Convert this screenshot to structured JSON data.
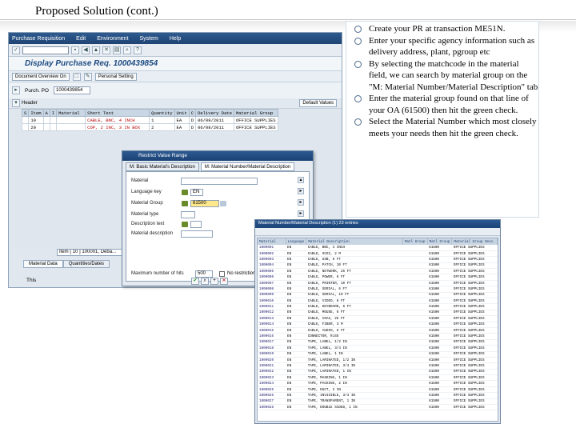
{
  "slide": {
    "title": "Proposed Solution (cont.)",
    "bullets": [
      "Create your PR at transaction ME51N.",
      "Enter your specific agency information such as delivery address, plant, pgroup etc",
      "By selecting the matchcode in the material field, we can search by material group on the \"M: Material Number/Material Description\" tab",
      "Enter the material group found on that line of your OA (61500) then hit the green check.",
      "Select the Material Number which most closely meets your needs then hit the green check."
    ]
  },
  "sap": {
    "menu": [
      "Purchase Requisition",
      "Edit",
      "Environment",
      "System",
      "Help"
    ],
    "title": "Display Purchase Req. 1000439854",
    "app_buttons": [
      "Document Overview On",
      "Personal Setting"
    ],
    "header_label": "Purch. PO",
    "pr_number": "1000439854",
    "header_section": "Header",
    "default_values": "Default Values",
    "item_columns": [
      "S",
      "Item",
      "A",
      "I",
      "Material",
      "Short Text",
      "Quantity",
      "Unit",
      "C",
      "Delivery Date",
      "Material Group"
    ],
    "items": [
      {
        "s": "",
        "item": "10",
        "a": "",
        "i": "",
        "material": "",
        "short_text": "CABLE, BNC, 4 INCH",
        "qty": "1",
        "unit": "EA",
        "c": "D",
        "date": "06/08/2011",
        "group": "OFFICE SUPPLIES",
        "warn": true
      },
      {
        "s": "",
        "item": "20",
        "a": "",
        "i": "",
        "material": "",
        "short_text": "COP, 2 INC, 3 IN BOX",
        "qty": "2",
        "unit": "EA",
        "c": "D",
        "date": "06/08/2011",
        "group": "OFFICE SUPPLIES",
        "warn": true
      }
    ],
    "bottom_field": "Item [ 10 ] 100001, Deba...",
    "bottom_tabs": [
      "Material Data",
      "Quantities/Dates"
    ],
    "bottom_label": "This"
  },
  "dialog": {
    "title": "Restrict Value Range",
    "tabs": [
      "M: Basic Material's Description",
      "M: Material Number/Material Description"
    ],
    "fields": [
      {
        "label": "Material",
        "value": ""
      },
      {
        "label": "Language key",
        "value": "EN"
      },
      {
        "label": "Material Group",
        "value": "61500"
      },
      {
        "label": "Material type",
        "value": ""
      },
      {
        "label": "Description text",
        "value": ""
      },
      {
        "label": "Material description",
        "value": ""
      }
    ],
    "max_hits_label": "Maximum number of hits",
    "max_hits_value": "500",
    "no_restriction_label": "No restriction"
  },
  "material_list": {
    "title": "Material Number/Material Description (1) 23 entries",
    "columns": [
      "Material",
      "Language",
      "Material Description",
      "Matl Group",
      "Matl Group",
      "Material Group Desc."
    ],
    "rows": [
      [
        "1000001",
        "EN",
        "CABLE, BNC, 4 INCH",
        "",
        "61500",
        "OFFICE SUPPLIES"
      ],
      [
        "1000002",
        "EN",
        "CABLE, SCSI, 2 M",
        "",
        "61500",
        "OFFICE SUPPLIES"
      ],
      [
        "1000003",
        "EN",
        "CABLE, USB, 6 FT",
        "",
        "61500",
        "OFFICE SUPPLIES"
      ],
      [
        "1000004",
        "EN",
        "CABLE, PATCH, 10 FT",
        "",
        "61500",
        "OFFICE SUPPLIES"
      ],
      [
        "1000005",
        "EN",
        "CABLE, NETWORK, 25 FT",
        "",
        "61500",
        "OFFICE SUPPLIES"
      ],
      [
        "1000006",
        "EN",
        "CABLE, POWER, 6 FT",
        "",
        "61500",
        "OFFICE SUPPLIES"
      ],
      [
        "1000007",
        "EN",
        "CABLE, PRINTER, 10 FT",
        "",
        "61500",
        "OFFICE SUPPLIES"
      ],
      [
        "1000008",
        "EN",
        "CABLE, SERIAL, 6 FT",
        "",
        "61500",
        "OFFICE SUPPLIES"
      ],
      [
        "1000009",
        "EN",
        "CABLE, SERIAL, 10 FT",
        "",
        "61500",
        "OFFICE SUPPLIES"
      ],
      [
        "1000010",
        "EN",
        "CABLE, VIDEO, 6 FT",
        "",
        "61500",
        "OFFICE SUPPLIES"
      ],
      [
        "1000011",
        "EN",
        "CABLE, KEYBOARD, 6 FT",
        "",
        "61500",
        "OFFICE SUPPLIES"
      ],
      [
        "1000012",
        "EN",
        "CABLE, MOUSE, 6 FT",
        "",
        "61500",
        "OFFICE SUPPLIES"
      ],
      [
        "1000013",
        "EN",
        "CABLE, COAX, 25 FT",
        "",
        "61500",
        "OFFICE SUPPLIES"
      ],
      [
        "1000014",
        "EN",
        "CABLE, FIBER, 3 M",
        "",
        "61500",
        "OFFICE SUPPLIES"
      ],
      [
        "1000015",
        "EN",
        "CABLE, AUDIO, 6 FT",
        "",
        "61500",
        "OFFICE SUPPLIES"
      ],
      [
        "1000016",
        "EN",
        "CONNECTOR, RJ45",
        "",
        "61500",
        "OFFICE SUPPLIES"
      ],
      [
        "1000017",
        "EN",
        "TAPE, LABEL, 1/2 IN",
        "",
        "61500",
        "OFFICE SUPPLIES"
      ],
      [
        "1000018",
        "EN",
        "TAPE, LABEL, 3/4 IN",
        "",
        "61500",
        "OFFICE SUPPLIES"
      ],
      [
        "1000019",
        "EN",
        "TAPE, LABEL, 1 IN",
        "",
        "61500",
        "OFFICE SUPPLIES"
      ],
      [
        "1000020",
        "EN",
        "TAPE, LAMINATED, 1/2 IN",
        "",
        "61500",
        "OFFICE SUPPLIES"
      ],
      [
        "1000021",
        "EN",
        "TAPE, LAMINATED, 3/4 IN",
        "",
        "61500",
        "OFFICE SUPPLIES"
      ],
      [
        "1000022",
        "EN",
        "TAPE, LAMINATED, 1 IN",
        "",
        "61500",
        "OFFICE SUPPLIES"
      ],
      [
        "1000023",
        "EN",
        "TAPE, MASKING, 1 IN",
        "",
        "61500",
        "OFFICE SUPPLIES"
      ],
      [
        "1000024",
        "EN",
        "TAPE, PACKING, 2 IN",
        "",
        "61500",
        "OFFICE SUPPLIES"
      ],
      [
        "1000025",
        "EN",
        "TAPE, DUCT, 2 IN",
        "",
        "61500",
        "OFFICE SUPPLIES"
      ],
      [
        "1000026",
        "EN",
        "TAPE, INVISIBLE, 3/4 IN",
        "",
        "61500",
        "OFFICE SUPPLIES"
      ],
      [
        "1000027",
        "EN",
        "TAPE, TRANSPARENT, 1 IN",
        "",
        "61500",
        "OFFICE SUPPLIES"
      ],
      [
        "1000028",
        "EN",
        "TAPE, DOUBLE SIDED, 1 IN",
        "",
        "61500",
        "OFFICE SUPPLIES"
      ]
    ]
  }
}
